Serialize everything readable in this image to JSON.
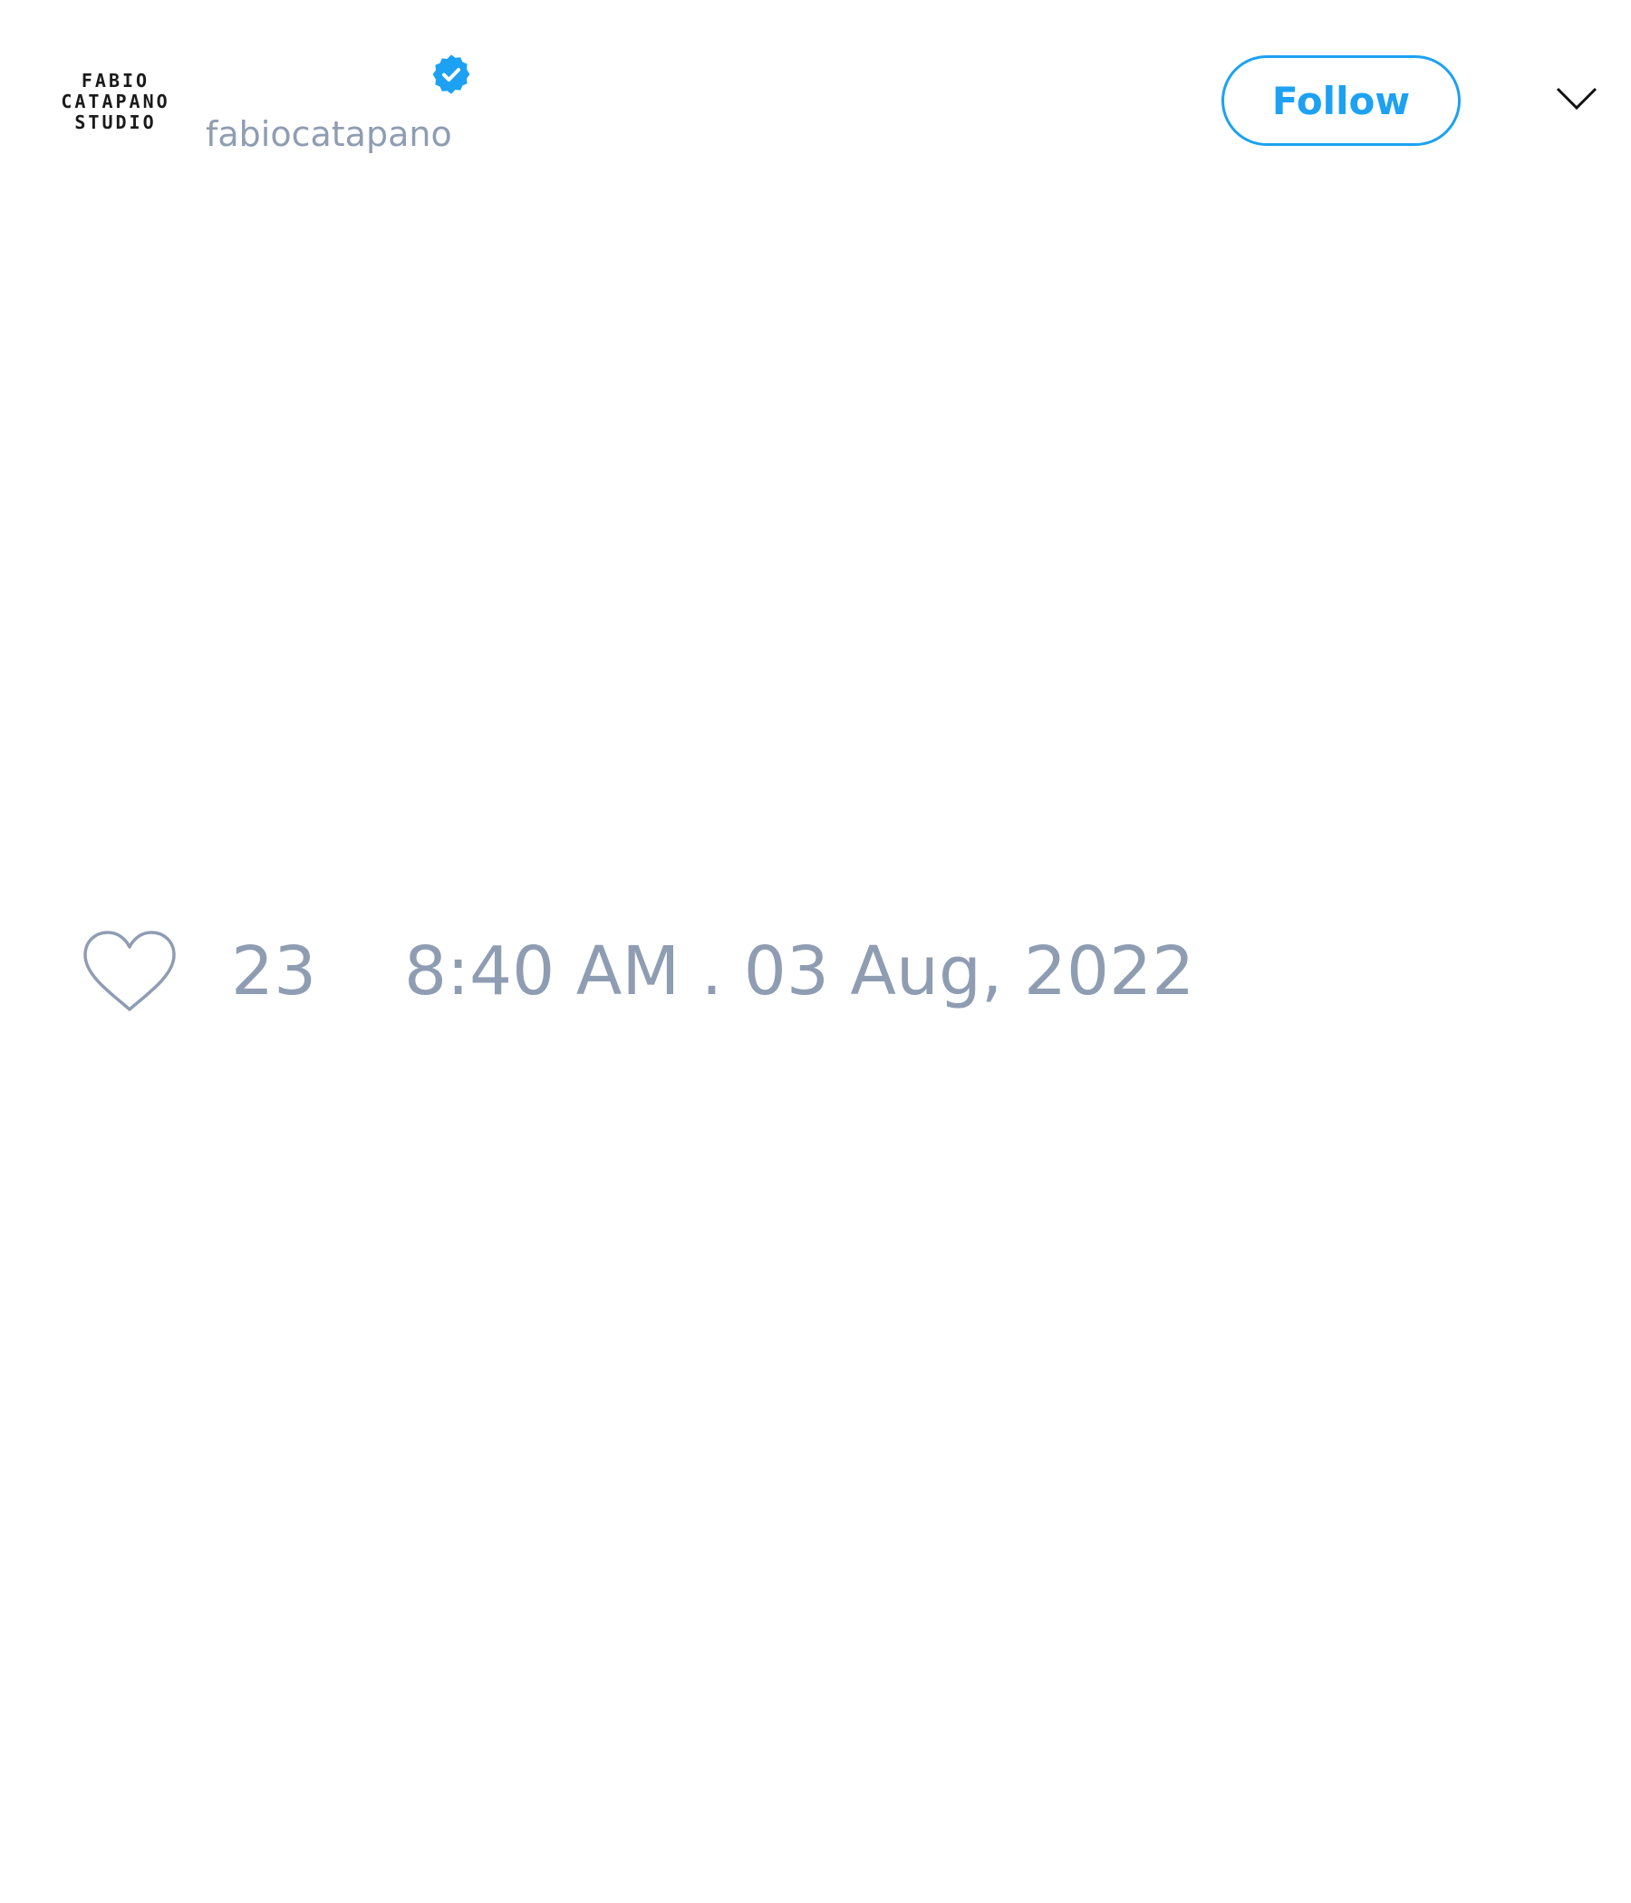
{
  "colors": {
    "accent": "#1da1f2",
    "muted_text": "#8f9db3",
    "background": "#ffffff"
  },
  "author": {
    "avatar_logo_lines": [
      "FABIO",
      "CATAPANO",
      "STUDIO"
    ],
    "handle": "fabiocatapano",
    "verified": true,
    "verified_icon": "verified-badge-icon"
  },
  "header": {
    "follow_label": "Follow",
    "menu_icon": "chevron-down-icon"
  },
  "tweet": {
    "like_icon": "heart-icon",
    "like_count": "23",
    "timestamp": "8:40 AM . 03 Aug, 2022"
  }
}
